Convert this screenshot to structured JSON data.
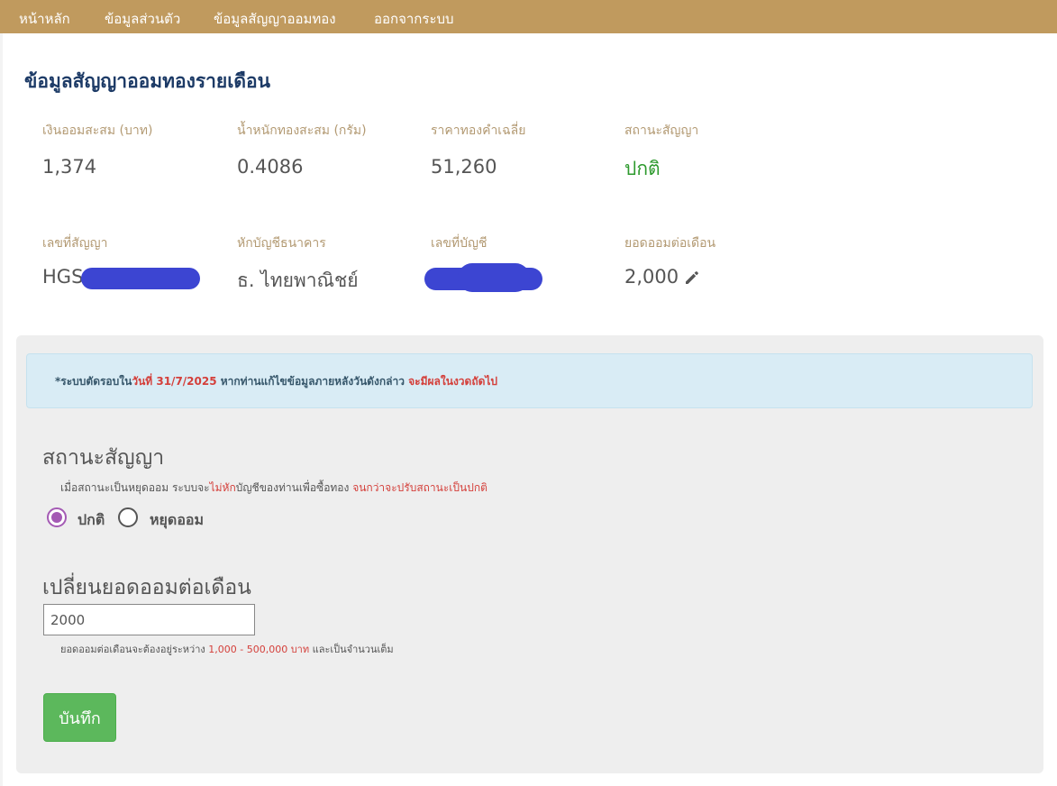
{
  "nav": {
    "items": [
      "หน้าหลัก",
      "ข้อมูลส่วนตัว",
      "ข้อมูลสัญญาออมทอง",
      "ออกจากระบบ"
    ]
  },
  "page": {
    "title": "ข้อมูลสัญญาออมทองรายเดือน"
  },
  "summary": {
    "savings_label": "เงินออมสะสม (บาท)",
    "savings_value": "1,374",
    "gold_weight_label": "น้ำหนักทองสะสม (กรัม)",
    "gold_weight_value": "0.4086",
    "avg_price_label": "ราคาทองคำเฉลี่ย",
    "avg_price_value": "51,260",
    "status_label": "สถานะสัญญา",
    "status_value": "ปกติ",
    "contract_no_label": "เลขที่สัญญา",
    "contract_no_value": "HGS",
    "bank_label": "หักบัญชีธนาคาร",
    "bank_value": "ธ. ไทยพาณิชย์",
    "account_no_label": "เลขที่บัญชี",
    "monthly_label": "ยอดออมต่อเดือน",
    "monthly_value": "2,000"
  },
  "alert": {
    "part1": "*ระบบตัดรอบใน",
    "part2": "วันที่ 31/7/2025",
    "part3": " หากท่านแก้ไขข้อมูลภายหลังวันดังกล่าว ",
    "part4": "จะมีผลในงวดถัดไป"
  },
  "status_section": {
    "title": "สถานะสัญญา",
    "note_part1": "เมื่อสถานะเป็นหยุดออม ระบบจะ",
    "note_part2": "ไม่หัก",
    "note_part3": "บัญชีของท่านเพื่อซื้อทอง ",
    "note_part4": "จนกว่าจะปรับสถานะเป็นปกติ",
    "options": [
      "ปกติ",
      "หยุดออม"
    ],
    "selected": "ปกติ"
  },
  "monthly_section": {
    "title": "เปลี่ยนยอดออมต่อเดือน",
    "input_value": "2000",
    "hint_part1": "ยอดออมต่อเดือนจะต้องอยู่ระหว่าง ",
    "hint_part2": "1,000 - 500,000 บาท",
    "hint_part3": " และเป็นจำนวนเต็ม"
  },
  "save_label": "บันทึก",
  "colors": {
    "nav_bg": "#c09a5e",
    "status_ok": "#2e9a2e",
    "radio_checked": "#a45ab4",
    "save_button": "#5cb85c",
    "warning_text": "#d43f3a"
  }
}
